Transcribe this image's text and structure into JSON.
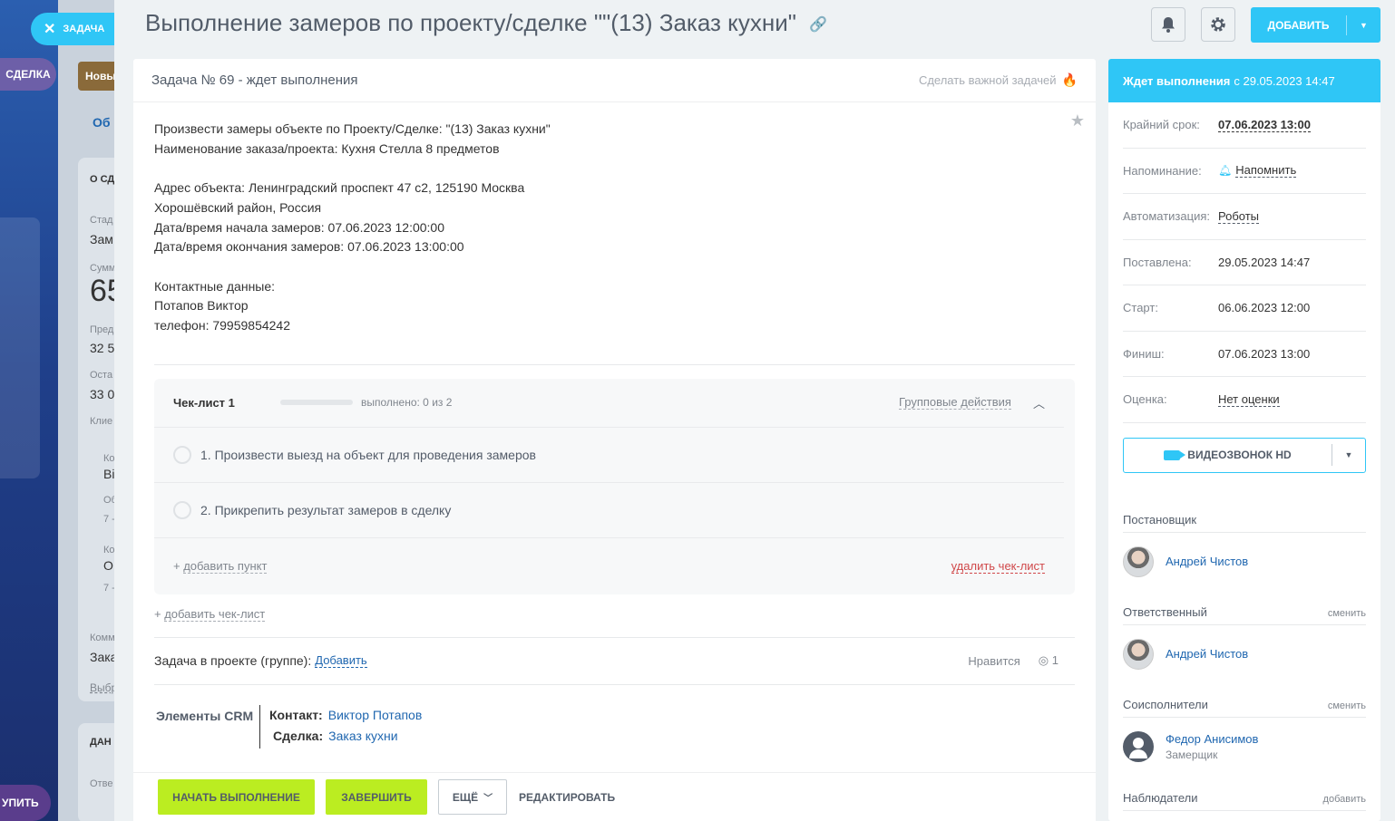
{
  "background": {
    "sdelka": "СДЕЛКА",
    "new_tag": "Новы",
    "tab": "Об",
    "section": "О СД",
    "stage_label": "Стад",
    "stage_value": "Зам",
    "sum_label": "Сумм",
    "sum_value": "65",
    "pred_label": "Пред",
    "pred_value": "32 5",
    "ost_label": "Оста",
    "ost_value": "33 0",
    "client_label": "Клие",
    "c1": "Ко",
    "c2": "Ві",
    "c3": "Об",
    "c4": "7 -",
    "c5": "Ко",
    "c6": "О",
    "c7": "7 -",
    "comment_label": "Комм",
    "comment_value": "Зака",
    "choose": "Выбр",
    "data_section": "ДАН",
    "resp_label": "Отве",
    "bottom_btn": "УПИТЬ"
  },
  "task_chip": "ЗАДАЧА",
  "title": "Выполнение замеров по проекту/сделке \"\"(13) Заказ кухни\"",
  "add_button": "ДОБАВИТЬ",
  "card": {
    "header": "Задача № 69 - ждет выполнения",
    "important": "Сделать важной задачей",
    "description": [
      "Произвести замеры объекте по Проекту/Сделке: \"(13) Заказ кухни\"",
      "Наименование заказа/проекта: Кухня Стелла 8 предметов",
      "",
      "Адрес объекта: Ленинградский проспект 47 с2, 125190 Москва",
      "Хорошёвский район, Россия",
      "Дата/время начала замеров: 07.06.2023 12:00:00",
      "Дата/время окончания замеров: 07.06.2023 13:00:00",
      "",
      "Контактные данные:",
      "Потапов Виктор",
      "телефон: 79959854242"
    ],
    "checklist": {
      "title": "Чек-лист 1",
      "progress_text": "выполнено: 0 из 2",
      "progress_fraction": 0,
      "group_actions": "Групповые действия",
      "items": [
        "1. Произвести выезд на объект для проведения замеров",
        "2. Прикрепить результат замеров в сделку"
      ],
      "add_item_prefix": "+ ",
      "add_item": "добавить пункт",
      "delete": "удалить чек-лист"
    },
    "add_checklist_prefix": "+ ",
    "add_checklist": "добавить чек-лист",
    "project_label": "Задача в проекте (группе):",
    "project_link": "Добавить",
    "like": "Нравится",
    "views": "1",
    "crm": {
      "label": "Элементы CRM",
      "contact_label": "Контакт:",
      "contact_value": "Виктор Потапов",
      "deal_label": "Сделка:",
      "deal_value": "Заказ кухни"
    }
  },
  "footer": {
    "start": "НАЧАТЬ ВЫПОЛНЕНИЕ",
    "finish": "ЗАВЕРШИТЬ",
    "more": "ЕЩЁ",
    "edit": "РЕДАКТИРОВАТЬ"
  },
  "sidebar": {
    "status_bold": "Ждет выполнения",
    "status_rest": "с 29.05.2023 14:47",
    "deadline_label": "Крайний срок:",
    "deadline_value": "07.06.2023 13:00",
    "reminder_label": "Напоминание:",
    "reminder_value": "Напомнить",
    "automation_label": "Автоматизация:",
    "automation_value": "Роботы",
    "created_label": "Поставлена:",
    "created_value": "29.05.2023 14:47",
    "start_label": "Старт:",
    "start_value": "06.06.2023 12:00",
    "finish_label": "Финиш:",
    "finish_value": "07.06.2023 13:00",
    "rating_label": "Оценка:",
    "rating_value": "Нет оценки",
    "video_button": "ВИДЕОЗВОНОК HD",
    "creator_section": "Постановщик",
    "creator_name": "Андрей Чистов",
    "responsible_section": "Ответственный",
    "responsible_change": "сменить",
    "responsible_name": "Андрей Чистов",
    "accomplices_section": "Соисполнители",
    "accomplices_change": "сменить",
    "accomplice_name": "Федор Анисимов",
    "accomplice_role": "Замерщик",
    "auditors_section": "Наблюдатели",
    "auditors_add": "добавить"
  },
  "colors": {
    "accent": "#2fc6f6",
    "green_button": "#bbed21",
    "link": "#2067b0"
  }
}
